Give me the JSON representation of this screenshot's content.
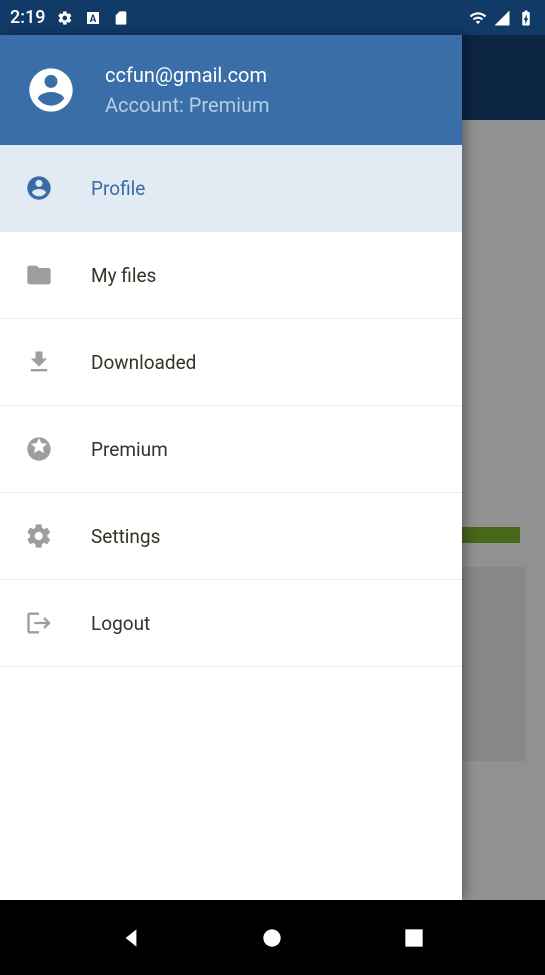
{
  "status": {
    "time": "2:19"
  },
  "header": {
    "email": "ccfun@gmail.com",
    "account": "Account: Premium"
  },
  "menu": {
    "profile": "Profile",
    "myfiles": "My files",
    "downloaded": "Downloaded",
    "premium": "Premium",
    "settings": "Settings",
    "logout": "Logout"
  }
}
